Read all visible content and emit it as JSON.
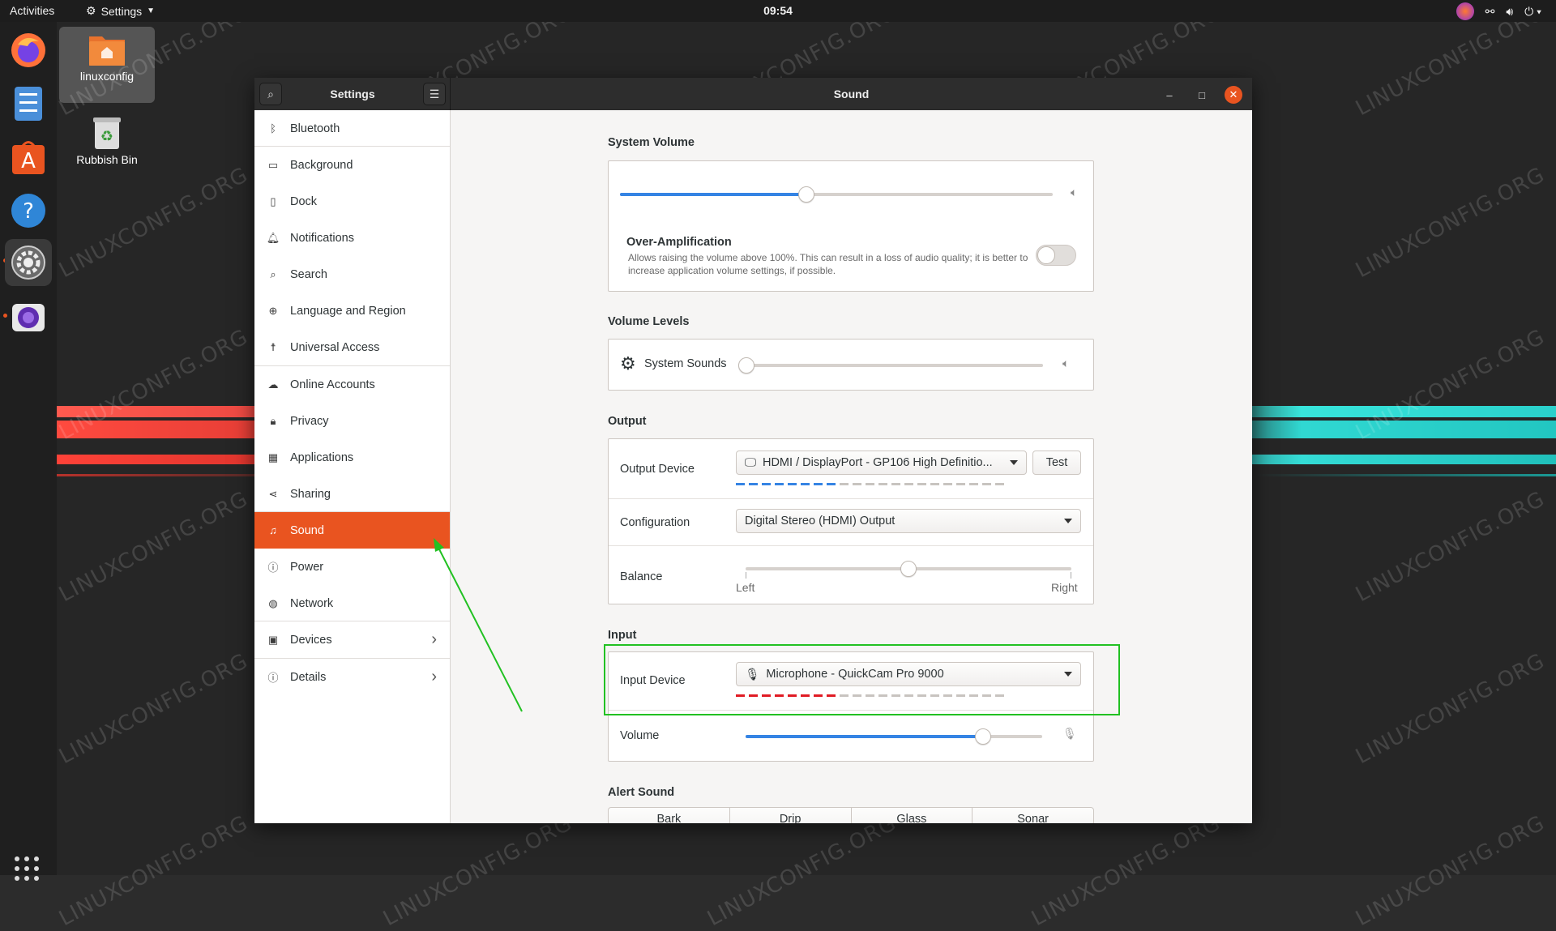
{
  "topbar": {
    "activities": "Activities",
    "app_menu": "Settings",
    "clock": "09:54"
  },
  "desktop": {
    "icons": [
      {
        "label": "linuxconfig",
        "icon": "home-folder-icon"
      },
      {
        "label": "Rubbish Bin",
        "icon": "trash-icon"
      }
    ],
    "watermark": "LINUXCONFIG.ORG"
  },
  "dock": {
    "apps": [
      "firefox-icon",
      "files-icon",
      "software-icon",
      "help-icon",
      "settings-icon",
      "screenshot-icon"
    ],
    "show_apps": "apps-grid-icon"
  },
  "window": {
    "sidebar_title": "Settings",
    "title": "Sound",
    "sidebar": [
      {
        "label": "Bluetooth",
        "icon": "bluetooth-icon"
      },
      {
        "label": "Background",
        "icon": "background-icon"
      },
      {
        "label": "Dock",
        "icon": "dock-icon"
      },
      {
        "label": "Notifications",
        "icon": "bell-icon"
      },
      {
        "label": "Search",
        "icon": "search-icon"
      },
      {
        "label": "Language and Region",
        "icon": "globe-icon"
      },
      {
        "label": "Universal Access",
        "icon": "accessibility-icon"
      },
      {
        "label": "Online Accounts",
        "icon": "cloud-icon"
      },
      {
        "label": "Privacy",
        "icon": "lock-icon"
      },
      {
        "label": "Applications",
        "icon": "apps-icon"
      },
      {
        "label": "Sharing",
        "icon": "share-icon"
      },
      {
        "label": "Sound",
        "icon": "music-note-icon",
        "active": true
      },
      {
        "label": "Power",
        "icon": "power-icon"
      },
      {
        "label": "Network",
        "icon": "network-icon"
      },
      {
        "label": "Devices",
        "icon": "devices-icon",
        "has_children": true
      },
      {
        "label": "Details",
        "icon": "info-icon",
        "has_children": true
      }
    ],
    "sound": {
      "system_volume": {
        "heading": "System Volume",
        "level": 0.43,
        "over_amp_title": "Over-Amplification",
        "over_amp_desc": "Allows raising the volume above 100%. This can result in a loss of audio quality; it is better to increase application volume settings, if possible.",
        "over_amp_enabled": false
      },
      "volume_levels": {
        "heading": "Volume Levels",
        "system_sounds_label": "System Sounds",
        "system_sounds_level": 0.0
      },
      "output": {
        "heading": "Output",
        "device_label": "Output Device",
        "device_value": "HDMI / DisplayPort - GP106 High Definitio...",
        "test_button": "Test",
        "meter_active": 8,
        "meter_total": 21,
        "config_label": "Configuration",
        "config_value": "Digital Stereo (HDMI) Output",
        "balance_label": "Balance",
        "balance_left": "Left",
        "balance_right": "Right",
        "balance": 0.5
      },
      "input": {
        "heading": "Input",
        "device_label": "Input Device",
        "device_value": "Microphone - QuickCam Pro 9000",
        "meter_active": 8,
        "meter_total": 21,
        "volume_label": "Volume",
        "volume_level": 0.8
      },
      "alert": {
        "heading": "Alert Sound",
        "options": [
          "Bark",
          "Drip",
          "Glass",
          "Sonar"
        ]
      }
    }
  },
  "colors": {
    "accent": "#e95420",
    "slider_blue": "#3584e4",
    "meter_red": "#e01b24",
    "annotation_green": "#22c122"
  }
}
